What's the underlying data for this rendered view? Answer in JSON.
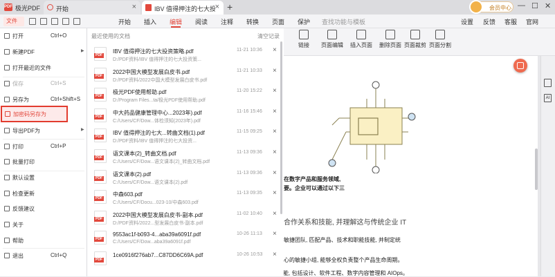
{
  "app": {
    "title": "极光PDF"
  },
  "tabs": [
    {
      "label": "开始"
    },
    {
      "label": "IBV 值得押注的七大投资",
      "active": true
    }
  ],
  "user": {
    "label": "会员中心"
  },
  "menu": {
    "file": "文件",
    "items": [
      "开始",
      "插入",
      "编辑",
      "阅读",
      "注释",
      "转换",
      "页面",
      "保护"
    ],
    "active": "编辑",
    "search_placeholder": "查找功能与模板",
    "right": [
      "设置",
      "反馈",
      "客服",
      "官网"
    ]
  },
  "toolbar": [
    "链接",
    "页面编辑",
    "插入页面",
    "删除页面",
    "页面裁剪",
    "页面分割"
  ],
  "file_menu": [
    {
      "label": "打开",
      "shortcut": "Ctrl+O"
    },
    {
      "label": "新建PDF",
      "submenu": true
    },
    {
      "label": "打开最近的文件"
    },
    {
      "label": "保存",
      "shortcut": "Ctrl+S",
      "disabled": true
    },
    {
      "label": "另存为",
      "shortcut": "Ctrl+Shift+S"
    },
    {
      "label": "加密码另存为",
      "highlighted": true
    },
    {
      "label": "导出PDF为",
      "submenu": true
    },
    {
      "label": "打印",
      "shortcut": "Ctrl+P"
    },
    {
      "label": "批量打印"
    },
    {
      "label": "默认设置"
    },
    {
      "label": "检查更新"
    },
    {
      "label": "反馈建议"
    },
    {
      "label": "关于"
    },
    {
      "label": "帮助"
    },
    {
      "label": "退出",
      "shortcut": "Ctrl+Q"
    }
  ],
  "recent": {
    "header": "最近使用的文档",
    "clear": "清空记录",
    "files": [
      {
        "name": "IBV 值得押注的七大投资策略.pdf",
        "path": "D:/PDF资料/IBV 值得押注的七大投资策...",
        "time": "11-21 10:36"
      },
      {
        "name": "2022中国大模型发展白皮书.pdf",
        "path": "D:/PDF资料/2022中国大模型发展白皮书.pdf",
        "time": "11-21 10:33"
      },
      {
        "name": "极光PDF使用帮助.pdf",
        "path": "D:/Program Files...ta/极光PDF使用帮助.pdf",
        "time": "11-20 15:22"
      },
      {
        "name": "中大药品健康管理中心...2023年).pdf",
        "path": "C:/Users/CF/Dow...体检须知(2023年).pdf",
        "time": "11-16 15:46"
      },
      {
        "name": "IBV 值得押注的七大...转曲文档(1).pdf",
        "path": "D:/PDF资料/IBV 值得押注的七大投资...",
        "time": "11-15 09:25"
      },
      {
        "name": "语文课本(2)_转曲文档.pdf",
        "path": "C:/Users/CF/Dow...语文课本(2)_转曲文档.pdf",
        "time": "11-13 09:36"
      },
      {
        "name": "语文课本(2).pdf",
        "path": "C:/Users/CF/Dow...语文课本(2).pdf",
        "time": "11-13 09:36"
      },
      {
        "name": "中森603.pdf",
        "path": "C:/Users/CF/Docu...023-10/中森603.pdf",
        "time": "11-13 09:35"
      },
      {
        "name": "2022中国大模型发展白皮书-副本.pdf",
        "path": "D:/PDF资料/2022...型发展白皮书-副本.pdf",
        "time": "11-02 10:40"
      },
      {
        "name": "9553ac1f-b093-4...aba39a6091f.pdf",
        "path": "C:/Users/CF/Dow...aba39a6091f.pdf",
        "time": "10-26 11:13"
      },
      {
        "name": "1ce0916f276ab7...C87DD6C69A.pdf",
        "path": "",
        "time": "10-26 10:53"
      }
    ]
  },
  "document": {
    "lines": [
      "在数字产品和服务领域,",
      "要。企业可以通过以下三",
      "合作关系和技能, 并理解这与传统企业 IT",
      "敏捷团队, 匹配产品、技术和职能技能, 并制定统",
      "心的敏捷小组, 能够全权负责整个产品生命周期。",
      "• 培养团队成员掌握新的数字技能, 包括设计、软件工程、数字内容管理和 AIOps。"
    ]
  },
  "colors": {
    "accent": "#e2483c",
    "chip": "#faf0c4",
    "chip_stroke": "#8a8050"
  }
}
